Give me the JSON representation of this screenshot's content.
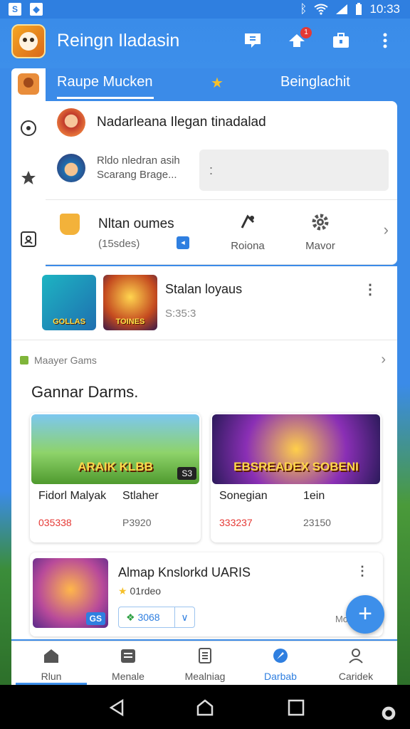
{
  "status_bar": {
    "time": "10:33"
  },
  "app_bar": {
    "title": "Reingn Iladasin",
    "notification_count": "1",
    "icons": [
      "shield-chat-icon",
      "notification-icon",
      "toolbox-icon",
      "more-vert-icon"
    ]
  },
  "tabs": {
    "items": [
      "Raupe Mucken",
      "Beinglachit"
    ],
    "selected": 0
  },
  "left_rail": {
    "icons": [
      "avatar-icon",
      "target-icon",
      "star-icon",
      "scan-icon",
      "pin-icon",
      "settings-icon"
    ]
  },
  "top_card": {
    "row1_text": "Nadarleana Ilegan tinadalad",
    "row2_text_line1": "Rldo nledran asih",
    "row2_text_line2": "Scarang Brage...",
    "search_value": ":",
    "row3_title": "Nltan oumes",
    "row3_sub": "(15sdes)",
    "action_1": "Roiona",
    "action_2": "Mavor"
  },
  "list_item": {
    "thumb_1_caption": "GOLLAS",
    "thumb_2_caption": "TOINES",
    "title": "Stalan loyaus",
    "sub": "S:35:3"
  },
  "games": {
    "section_label": "Maayer Gams",
    "section_title": "Gannar Darms.",
    "cards": [
      {
        "caption": "ARAIK KLBB",
        "badge": "S3",
        "name_a": "Fidorl Malyak",
        "name_b": "Stlaher",
        "value_a": "035338",
        "value_b": "P3920"
      },
      {
        "caption": "EBSREADEX SOBENI",
        "name_a": "Sonegian",
        "name_b": "1ein",
        "value_a": "333237",
        "value_b": "23150"
      }
    ],
    "feature": {
      "title": "Almap Knslorkd UARIS",
      "rating": "01rdeo",
      "price": "3068",
      "tag": "GS",
      "more_label": "Monns"
    }
  },
  "bottom_nav": {
    "items": [
      "Rlun",
      "Menale",
      "Mealniag",
      "Darbab",
      "Caridek"
    ],
    "selected": 3
  }
}
